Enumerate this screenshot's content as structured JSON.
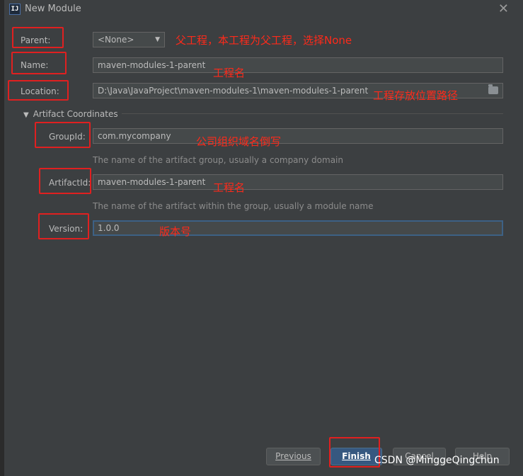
{
  "window": {
    "title": "New Module",
    "app_icon_text": "IJ"
  },
  "form": {
    "parent": {
      "label": "Parent:",
      "value": "<None>"
    },
    "name": {
      "label": "Name:",
      "value": "maven-modules-1-parent"
    },
    "location": {
      "label": "Location:",
      "value": "D:\\Java\\JavaProject\\maven-modules-1\\maven-modules-1-parent"
    },
    "artifact_coordinates": {
      "title": "Artifact Coordinates",
      "group_id": {
        "label": "GroupId:",
        "value": "com.mycompany",
        "hint": "The name of the artifact group, usually a company domain"
      },
      "artifact_id": {
        "label": "ArtifactId:",
        "value": "maven-modules-1-parent",
        "hint": "The name of the artifact within the group, usually a module name"
      },
      "version": {
        "label": "Version:",
        "value": "1.0.0"
      }
    }
  },
  "annotations": {
    "parent_note": "父工程，本工程为父工程，选择None",
    "name_note": "工程名",
    "location_note": "工程存放位置路径",
    "group_note": "公司组织域名倒写",
    "artifact_note": "工程名",
    "version_note": "版本号"
  },
  "buttons": {
    "previous": "Previous",
    "finish": "Finish",
    "cancel": "Cancel",
    "help": "Help"
  },
  "watermark": "CSDN @MinggeQingchun",
  "colors": {
    "background": "#3c3f41",
    "annotation_red": "#e02020",
    "primary_button": "#365880",
    "focus_border": "#3d6185"
  }
}
